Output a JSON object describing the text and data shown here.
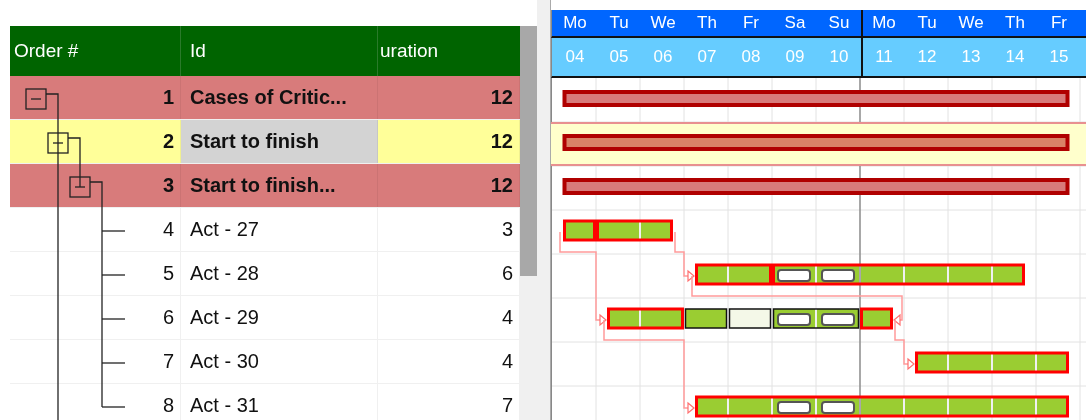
{
  "table": {
    "columns": [
      {
        "label": "Order #"
      },
      {
        "label": "Id"
      },
      {
        "label": "uration"
      }
    ],
    "rows": [
      {
        "order": "1",
        "id": "Cases of Critic...",
        "duration": "12",
        "critical": true,
        "selected": false,
        "focused_id": false,
        "expanded": true,
        "bar": [
          {
            "kind": "summary"
          },
          {
            "kind": "summary"
          },
          {
            "kind": "summary"
          },
          {
            "kind": "summary"
          },
          {
            "kind": "summary"
          },
          {
            "kind": "summary"
          },
          {
            "kind": "summary"
          },
          {
            "kind": "summary"
          },
          {
            "kind": "summary"
          },
          {
            "kind": "summary"
          },
          {
            "kind": "summary"
          },
          {
            "kind": "summary"
          }
        ],
        "children": [
          {
            "order": "2",
            "id": "Start to finish",
            "duration": "12",
            "critical": true,
            "selected": true,
            "focused_id": true,
            "expanded": true,
            "more_siblings_below": true,
            "bar": [
              {
                "kind": "summary"
              },
              {
                "kind": "summary"
              },
              {
                "kind": "summary"
              },
              {
                "kind": "summary"
              },
              {
                "kind": "summary"
              },
              {
                "kind": "summary"
              },
              {
                "kind": "summary"
              },
              {
                "kind": "summary"
              },
              {
                "kind": "summary"
              },
              {
                "kind": "summary"
              },
              {
                "kind": "summary"
              },
              {
                "kind": "summary"
              }
            ],
            "children": [
              {
                "order": "3",
                "id": "Start to finish...",
                "duration": "12",
                "critical": true,
                "selected": false,
                "focused_id": false,
                "expanded": true,
                "bar": [
                  {
                    "kind": "summary"
                  },
                  {
                    "kind": "summary"
                  },
                  {
                    "kind": "summary"
                  },
                  {
                    "kind": "summary"
                  },
                  {
                    "kind": "summary"
                  },
                  {
                    "kind": "summary"
                  },
                  {
                    "kind": "summary"
                  },
                  {
                    "kind": "summary"
                  },
                  {
                    "kind": "summary"
                  },
                  {
                    "kind": "summary"
                  },
                  {
                    "kind": "summary"
                  },
                  {
                    "kind": "summary"
                  }
                ],
                "children": [
                  {
                    "order": "4",
                    "id": "Act - 27",
                    "duration": "3",
                    "critical": false,
                    "selected": false,
                    "focused_id": false,
                    "bar": [
                      {
                        "kind": "critical"
                      },
                      {
                        "kind": "critical-split"
                      },
                      {
                        "kind": "critical"
                      },
                      {
                        "kind": "none"
                      },
                      {
                        "kind": "none"
                      },
                      {
                        "kind": "none"
                      },
                      {
                        "kind": "none"
                      },
                      {
                        "kind": "none"
                      },
                      {
                        "kind": "none"
                      },
                      {
                        "kind": "none"
                      },
                      {
                        "kind": "none"
                      },
                      {
                        "kind": "none"
                      }
                    ],
                    "successors": [
                      {
                        "kind": "finish_to_start"
                      },
                      {
                        "kind": "start_to_start"
                      },
                      {
                        "kind": "none"
                      },
                      {
                        "kind": "none"
                      }
                    ]
                  },
                  {
                    "order": "5",
                    "id": "Act - 28",
                    "duration": "6",
                    "critical": false,
                    "selected": false,
                    "focused_id": false,
                    "bar": [
                      {
                        "kind": "none"
                      },
                      {
                        "kind": "none"
                      },
                      {
                        "kind": "none"
                      },
                      {
                        "kind": "critical"
                      },
                      {
                        "kind": "critical"
                      },
                      {
                        "kind": "critical-split-break"
                      },
                      {
                        "kind": "critical-break"
                      },
                      {
                        "kind": "critical"
                      },
                      {
                        "kind": "critical"
                      },
                      {
                        "kind": "critical"
                      },
                      {
                        "kind": "critical"
                      },
                      {
                        "kind": "none"
                      }
                    ],
                    "successors": [
                      {
                        "kind": "start_to_finish"
                      },
                      {
                        "kind": "none"
                      },
                      {
                        "kind": "none"
                      }
                    ]
                  },
                  {
                    "order": "6",
                    "id": "Act - 29",
                    "duration": "4",
                    "critical": false,
                    "selected": false,
                    "focused_id": false,
                    "bar": [
                      {
                        "kind": "none"
                      },
                      {
                        "kind": "critical"
                      },
                      {
                        "kind": "critical"
                      },
                      {
                        "kind": "normal-split"
                      },
                      {
                        "kind": "idle-split"
                      },
                      {
                        "kind": "normal-split-break"
                      },
                      {
                        "kind": "normal-break"
                      },
                      {
                        "kind": "critical-split"
                      },
                      {
                        "kind": "none"
                      },
                      {
                        "kind": "none"
                      },
                      {
                        "kind": "none"
                      },
                      {
                        "kind": "none"
                      }
                    ],
                    "successors": [
                      {
                        "kind": "finish_to_start"
                      },
                      {
                        "kind": "start_to_start"
                      }
                    ]
                  },
                  {
                    "order": "7",
                    "id": "Act - 30",
                    "duration": "4",
                    "critical": false,
                    "selected": false,
                    "focused_id": false,
                    "bar": [
                      {
                        "kind": "none"
                      },
                      {
                        "kind": "none"
                      },
                      {
                        "kind": "none"
                      },
                      {
                        "kind": "none"
                      },
                      {
                        "kind": "none"
                      },
                      {
                        "kind": "none"
                      },
                      {
                        "kind": "none"
                      },
                      {
                        "kind": "none"
                      },
                      {
                        "kind": "critical"
                      },
                      {
                        "kind": "critical"
                      },
                      {
                        "kind": "critical"
                      },
                      {
                        "kind": "critical"
                      }
                    ],
                    "successors": [
                      {
                        "kind": "none"
                      }
                    ]
                  },
                  {
                    "order": "8",
                    "id": "Act - 31",
                    "duration": "7",
                    "critical": false,
                    "selected": false,
                    "focused_id": false,
                    "bar": [
                      {
                        "kind": "none"
                      },
                      {
                        "kind": "none"
                      },
                      {
                        "kind": "none"
                      },
                      {
                        "kind": "critical"
                      },
                      {
                        "kind": "critical"
                      },
                      {
                        "kind": "critical-break"
                      },
                      {
                        "kind": "critical-break"
                      },
                      {
                        "kind": "critical"
                      },
                      {
                        "kind": "critical"
                      },
                      {
                        "kind": "critical"
                      },
                      {
                        "kind": "critical"
                      },
                      {
                        "kind": "critical"
                      }
                    ]
                  }
                ]
              }
            ]
          }
        ]
      }
    ]
  },
  "timeline": {
    "days": [
      {
        "day": "Mo",
        "date": "04"
      },
      {
        "day": "Tu",
        "date": "05"
      },
      {
        "day": "We",
        "date": "06"
      },
      {
        "day": "Th",
        "date": "07"
      },
      {
        "day": "Fr",
        "date": "08"
      },
      {
        "day": "Sa",
        "date": "09"
      },
      {
        "day": "Su",
        "date": "10"
      },
      {
        "day": "Mo",
        "date": "11"
      },
      {
        "day": "Tu",
        "date": "12"
      },
      {
        "day": "We",
        "date": "13"
      },
      {
        "day": "Th",
        "date": "14"
      },
      {
        "day": "Fr",
        "date": "15"
      }
    ]
  }
}
